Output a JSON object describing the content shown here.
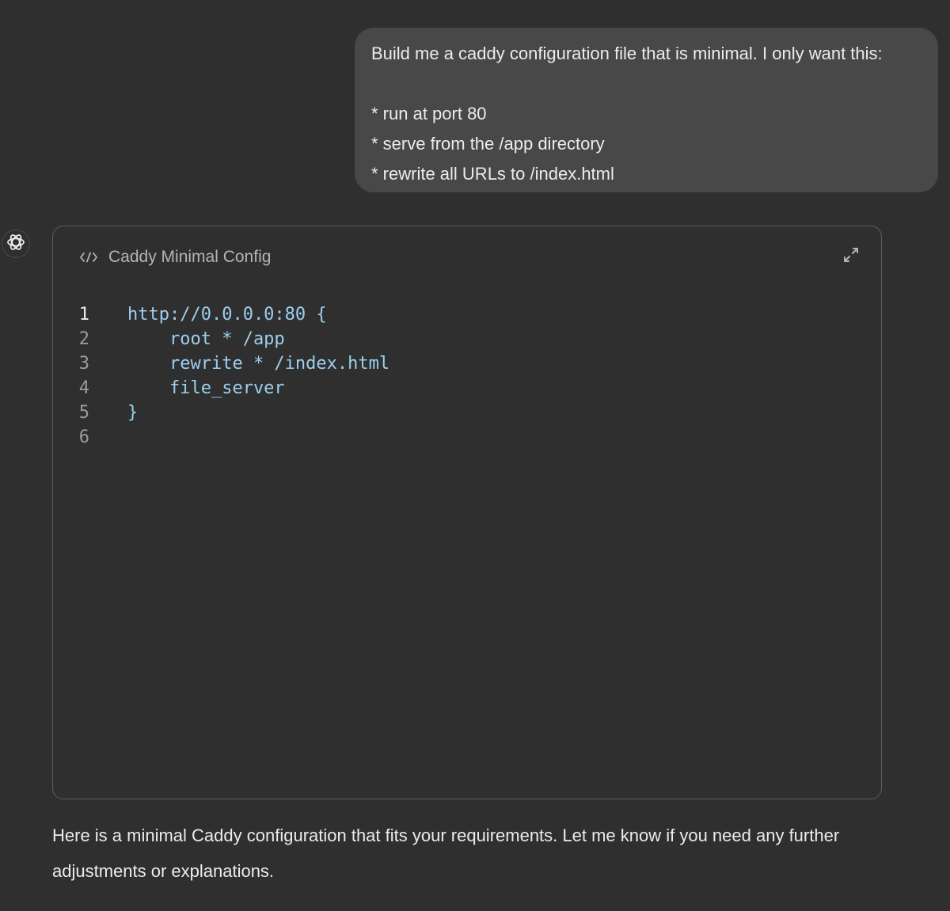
{
  "user_message": {
    "lines": [
      "Build me a caddy configuration file that is minimal. I only want this:",
      "",
      "* run at port 80",
      "* serve from the /app directory",
      "* rewrite all URLs to /index.html"
    ]
  },
  "assistant": {
    "avatar_icon": "openai-logo-icon",
    "canvas": {
      "title_icon": "code-brackets-icon",
      "title": "Caddy Minimal Config",
      "expand_icon": "expand-icon",
      "code_lines": [
        {
          "number": "1",
          "text": "http://0.0.0.0:80 {"
        },
        {
          "number": "2",
          "text": "    root * /app"
        },
        {
          "number": "3",
          "text": "    rewrite * /index.html"
        },
        {
          "number": "4",
          "text": "    file_server"
        },
        {
          "number": "5",
          "text": "}"
        },
        {
          "number": "6",
          "text": ""
        }
      ]
    },
    "reply": "Here is a minimal Caddy configuration that fits your requirements. Let me know if you need any further adjustments or explanations."
  },
  "colors": {
    "background": "#2f2f2f",
    "user_bubble": "#484848",
    "code_text": "#9ccfee",
    "border": "#5d5d5d"
  }
}
